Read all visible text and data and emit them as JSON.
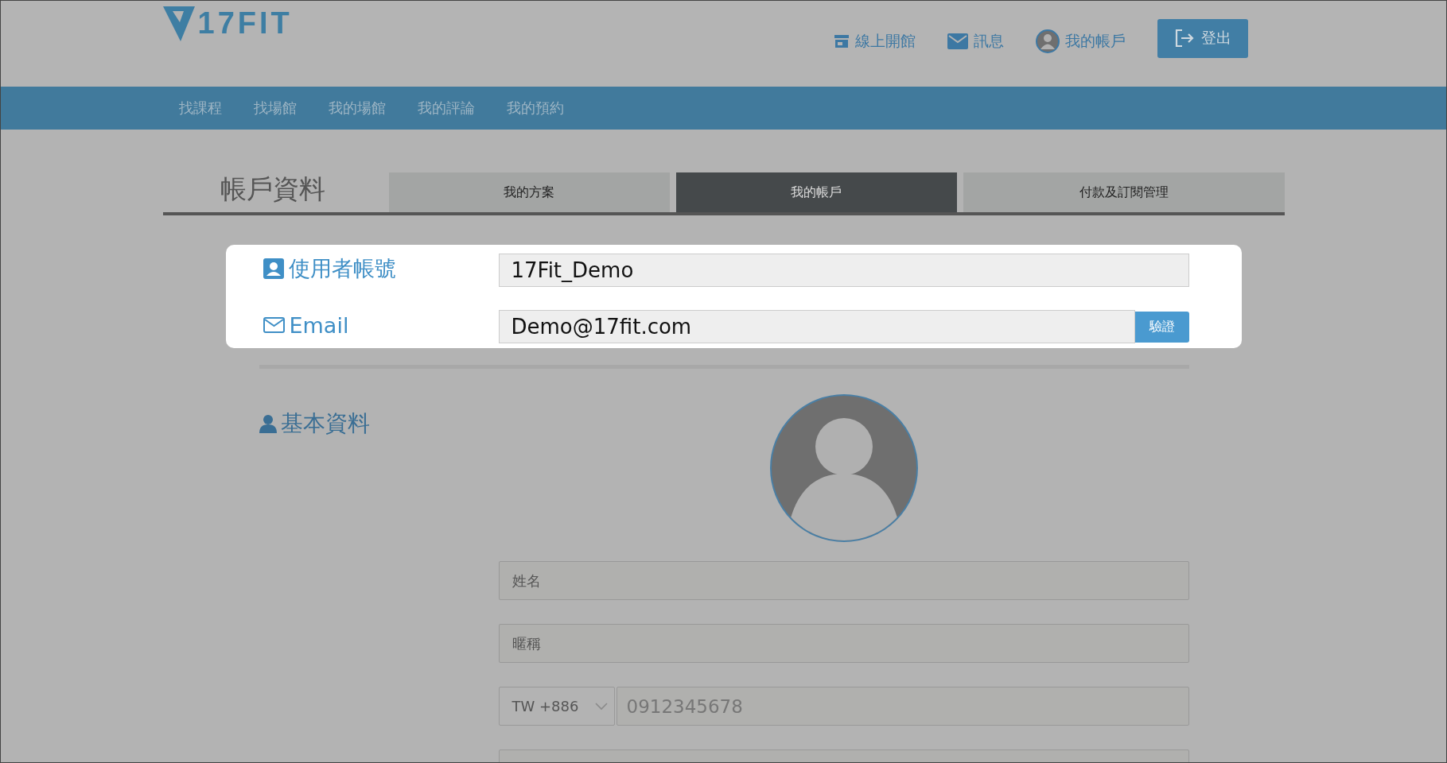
{
  "logo": {
    "text": "17FIT"
  },
  "header_links": [
    {
      "kind": "store",
      "label": "線上開館"
    },
    {
      "kind": "mail",
      "label": "訊息"
    },
    {
      "kind": "account",
      "label": "我的帳戶"
    }
  ],
  "logout_button": {
    "label": "登出"
  },
  "nav": [
    "找課程",
    "找場館",
    "我的場館",
    "我的評論",
    "我的預約"
  ],
  "page_title": "帳戶資料",
  "tabs": [
    {
      "label": "我的方案",
      "selected": false
    },
    {
      "label": "我的帳戶",
      "selected": true
    },
    {
      "label": "付款及訂閱管理",
      "selected": false
    }
  ],
  "account_card": {
    "username": {
      "label": "使用者帳號",
      "value": "17Fit_Demo"
    },
    "email": {
      "label": "Email",
      "value": "Demo@17fit.com",
      "verify_button": "驗證"
    }
  },
  "basic_info": {
    "heading": "基本資料",
    "fields": [
      {
        "placeholder": "姓名"
      },
      {
        "placeholder": "暱稱"
      }
    ],
    "phone": {
      "country": "TW +886",
      "placeholder": "0912345678"
    }
  }
}
